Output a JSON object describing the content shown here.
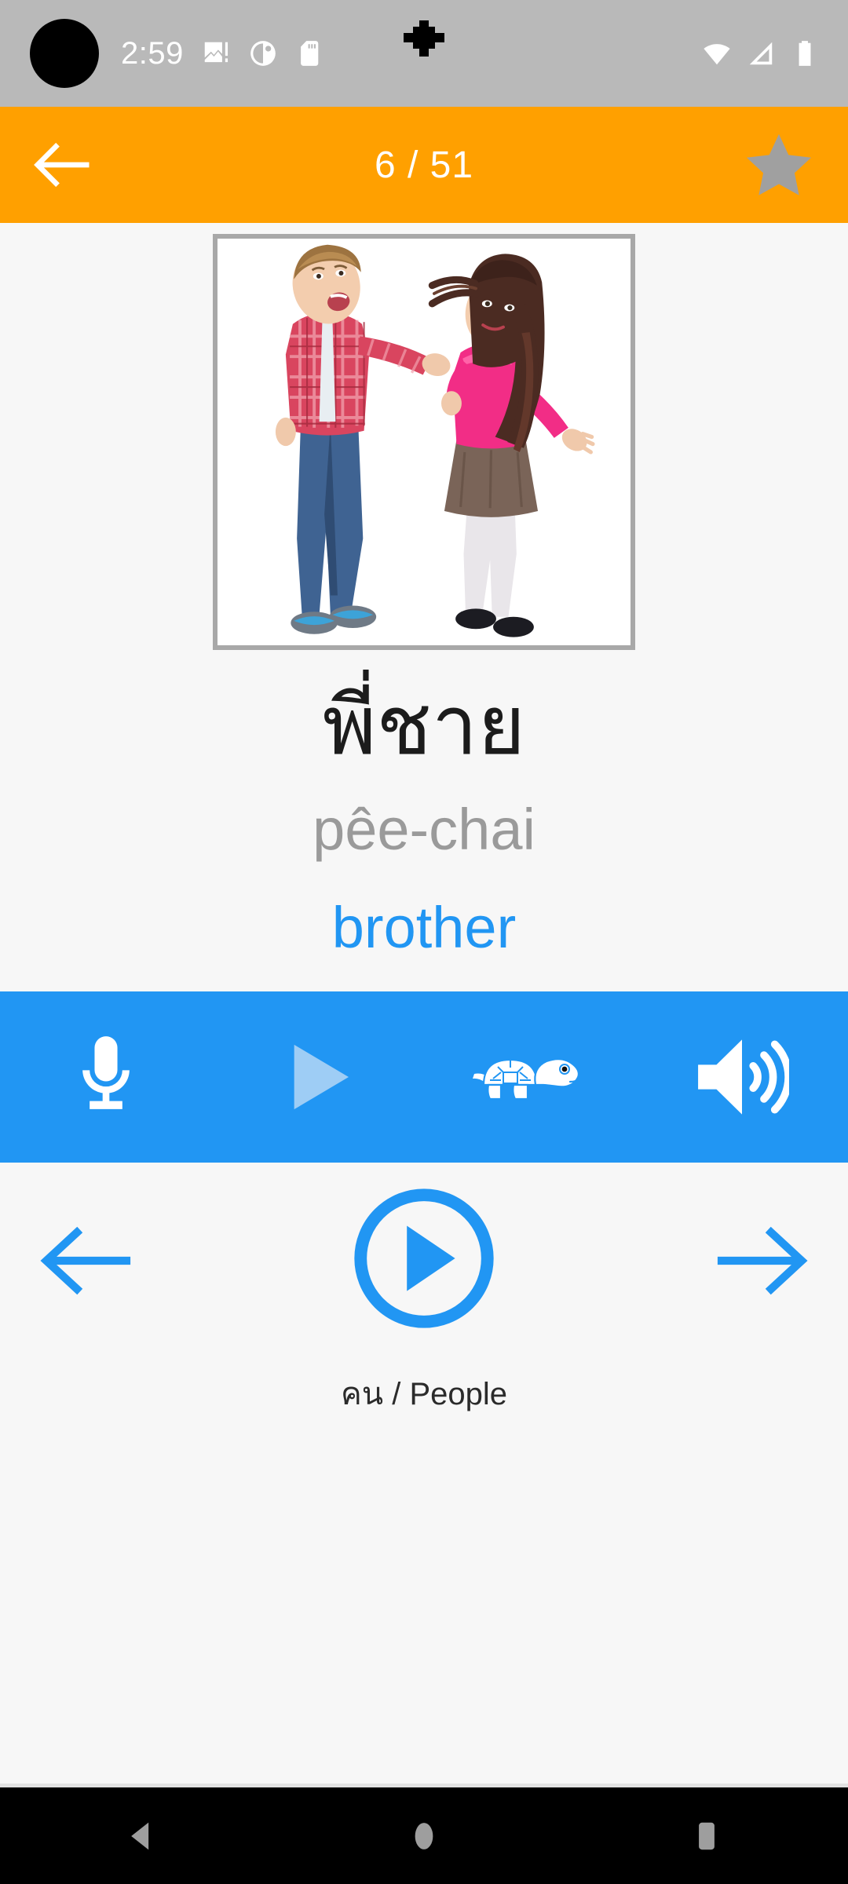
{
  "status_bar": {
    "time": "2:59",
    "icons_left": [
      "broken-image-icon",
      "circle-contrast-icon",
      "sd-card-icon"
    ],
    "icons_right": [
      "wifi-icon",
      "cellular-signal-icon",
      "battery-icon"
    ],
    "background_color": "#b9b9b9",
    "notch": "camera-cutout"
  },
  "header": {
    "back_label": "back-arrow",
    "counter": "6 / 51",
    "current": 6,
    "total": 51,
    "star_label": "favorite-star",
    "star_active": false,
    "background_color": "#ffa000",
    "star_color": "#a0a0a0"
  },
  "card": {
    "image_alt": "Boy in red plaid shirt pulling a girl's long hair; girl wears pink top and brown skirt",
    "thai": "พี่ชาย",
    "romanization": "pêe-chai",
    "english": "brother",
    "thai_color": "#1c1c1c",
    "romanization_color": "#9a9a9a",
    "english_color": "#2196f3"
  },
  "audio_bar": {
    "background_color": "#2196f3",
    "buttons": [
      {
        "name": "record-microphone",
        "icon": "microphone-icon",
        "enabled": true
      },
      {
        "name": "play-recording",
        "icon": "play-triangle-icon",
        "enabled": false
      },
      {
        "name": "play-slow",
        "icon": "turtle-icon",
        "enabled": true
      },
      {
        "name": "play-audio",
        "icon": "speaker-volume-icon",
        "enabled": true
      }
    ]
  },
  "navigation": {
    "previous_label": "previous-card",
    "play_label": "play-card-audio",
    "next_label": "next-card",
    "category": "คน / People",
    "accent_color": "#2196f3"
  },
  "system_nav": {
    "back": "back-triangle",
    "home": "home-circle",
    "recents": "recents-square",
    "icon_color": "#9e9e9e"
  }
}
